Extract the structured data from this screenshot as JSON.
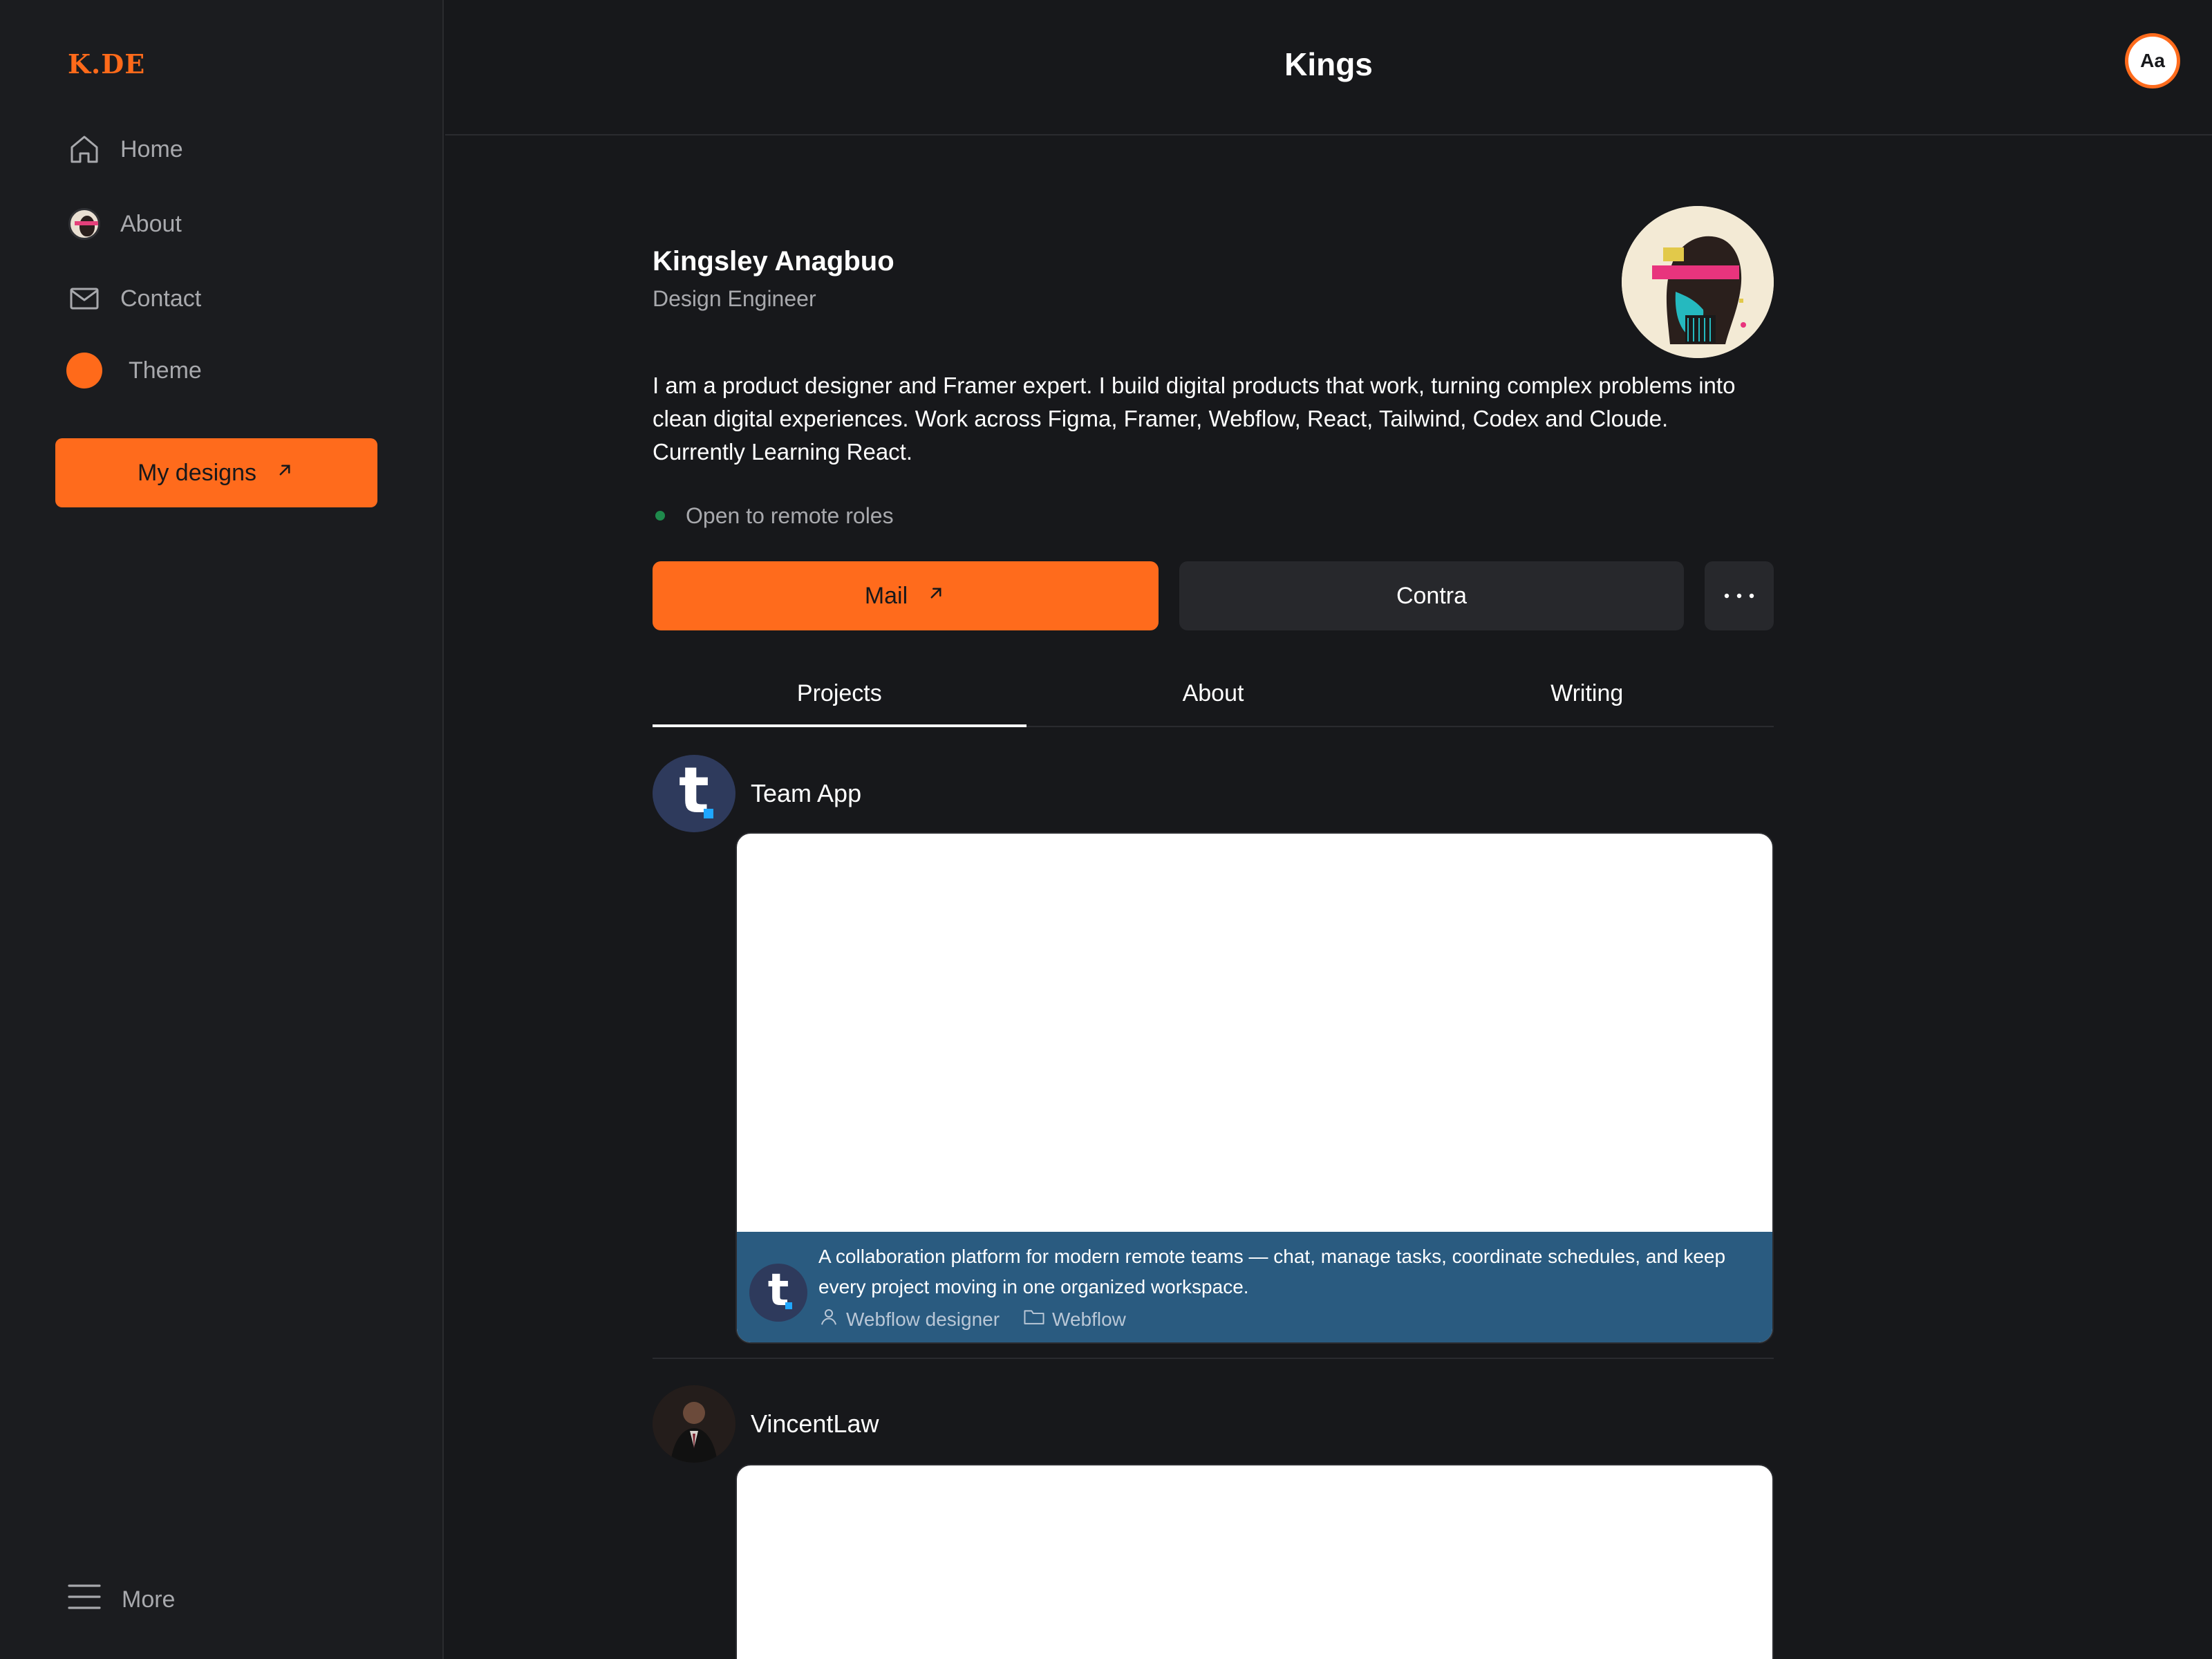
{
  "sidebar": {
    "logo": "K.DE",
    "nav": {
      "home": "Home",
      "about": "About",
      "contact": "Contact",
      "theme": "Theme"
    },
    "cta_label": "My designs",
    "more_label": "More"
  },
  "header": {
    "title": "Kings",
    "font_toggle": "Aa"
  },
  "profile": {
    "name": "Kingsley Anagbuo",
    "role": "Design Engineer",
    "bio": "I am a product designer and Framer expert. I build digital products that work, turning complex problems into clean digital experiences. Work across Figma, Framer, Webflow, React, Tailwind, Codex and Cloude. Currently Learning React.",
    "status": "Open to remote roles",
    "mail_label": "Mail",
    "contra_label": "Contra"
  },
  "tabs": [
    {
      "label": "Projects",
      "active": true
    },
    {
      "label": "About",
      "active": false
    },
    {
      "label": "Writing",
      "active": false
    }
  ],
  "projects": [
    {
      "name": "Team App",
      "description": "A collaboration platform for modern remote teams — chat, manage tasks, coordinate schedules, and keep every project moving in one organized workspace.",
      "role": "Webflow designer",
      "tool": "Webflow"
    },
    {
      "name": "VincentLaw"
    }
  ],
  "colors": {
    "accent": "#ff6b1c",
    "background": "#17181b",
    "sidebar": "#1b1c1f",
    "caption": "#2a5b80",
    "status_dot": "#1f8a4c"
  }
}
